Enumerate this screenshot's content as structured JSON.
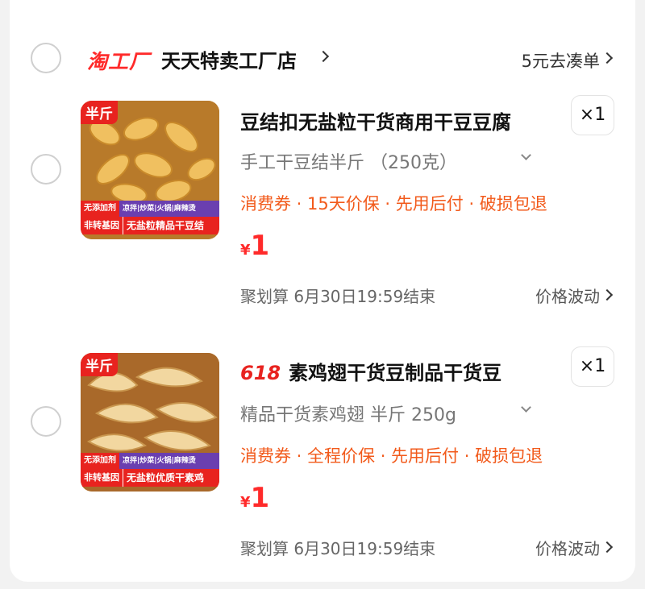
{
  "shop": {
    "brand": "淘工厂",
    "name": "天天特卖工厂店",
    "coudan": "5元去凑单"
  },
  "items": [
    {
      "title": "豆结扣无盐粒干货商用干豆豆腐",
      "tag": "",
      "quantity": "×1",
      "sku": "手工干豆结半斤 （250克）",
      "services": "消费券 · 15天价保 · 先用后付 · 破损包退",
      "currency": "¥",
      "price": "1",
      "deal": "聚划算 6月30日19:59结束",
      "price_fluct": "价格波动",
      "thumb": {
        "half_label": "半斤",
        "band1_left": "无添加剂",
        "band1_right": "凉拌|炒菜|火锅|麻辣烫",
        "band2_left": "非转基因",
        "band2_right": "无盐粒精品干豆结"
      }
    },
    {
      "title": "素鸡翅干货豆制品干货豆",
      "tag": "618",
      "quantity": "×1",
      "sku": "精品干货素鸡翅 半斤 250g",
      "services": "消费券 · 全程价保 · 先用后付 · 破损包退",
      "currency": "¥",
      "price": "1",
      "deal": "聚划算 6月30日19:59结束",
      "price_fluct": "价格波动",
      "thumb": {
        "half_label": "半斤",
        "band1_left": "无添加剂",
        "band1_right": "凉拌|炒菜|火锅|麻辣烫",
        "band2_left": "非转基因",
        "band2_right": "无盐粒优质干素鸡"
      }
    }
  ],
  "colors": {
    "accent": "#ff2a2a",
    "service": "#f25a1b",
    "background": "#f2f2f2"
  }
}
